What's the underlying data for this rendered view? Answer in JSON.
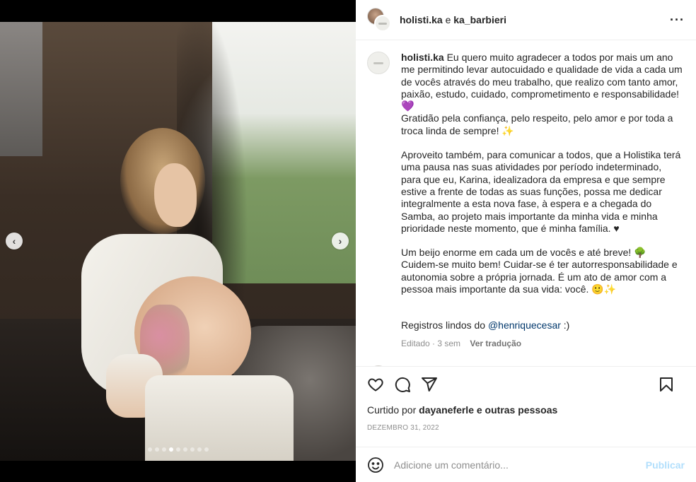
{
  "header": {
    "user1": "holisti.ka",
    "connector": "e",
    "user2": "ka_barbieri",
    "more_icon": "more-horizontal-icon"
  },
  "caption": {
    "username": "holisti.ka",
    "p1": "Eu quero muito agradecer a todos por mais um ano me permitindo levar autocuidado e qualidade de vida a cada um de vocês através do meu trabalho, que realizo com tanto amor, paixão, estudo, cuidado, comprometimento e responsabilidade!",
    "p1_emoji": "💜",
    "p2": "Gratidão pela confiança, pelo respeito, pelo amor e por toda a troca linda de sempre! ✨",
    "p3": "Aproveito também, para comunicar a todos, que a Holistika terá uma pausa nas suas atividades por período indeterminado, para que eu, Karina, idealizadora da empresa e que sempre estive a frente de todas as suas funções, possa me dedicar integralmente a esta nova fase, à espera e a chegada do Samba, ao projeto mais importante da minha vida e minha prioridade neste momento, que é minha família. ♥",
    "p4": "Um beijo enorme em cada um de vocês e até breve! 🌳 Cuidem-se muito bem! Cuidar-se é ter autorresponsabilidade e autonomia sobre a própria jornada. É um ato de amor com a pessoa mais importante da sua vida: você. 🙂✨",
    "p5_prefix": "Registros lindos do",
    "p5_mention": "@henriquecesar",
    "p5_suffix": ":)",
    "edited": "Editado · 3 sem",
    "translate": "Ver tradução"
  },
  "actions": {
    "like_icon": "heart-icon",
    "comment_icon": "comment-icon",
    "share_icon": "send-icon",
    "save_icon": "bookmark-icon"
  },
  "likes": {
    "prefix": "Curtido por",
    "user": "dayaneferle",
    "suffix": "e outras pessoas"
  },
  "date": "DEZEMBRO 31, 2022",
  "comment": {
    "placeholder": "Adicione um comentário...",
    "publish": "Publicar",
    "emoji_icon": "smiley-icon"
  },
  "carousel": {
    "total": 9,
    "active": 4
  }
}
